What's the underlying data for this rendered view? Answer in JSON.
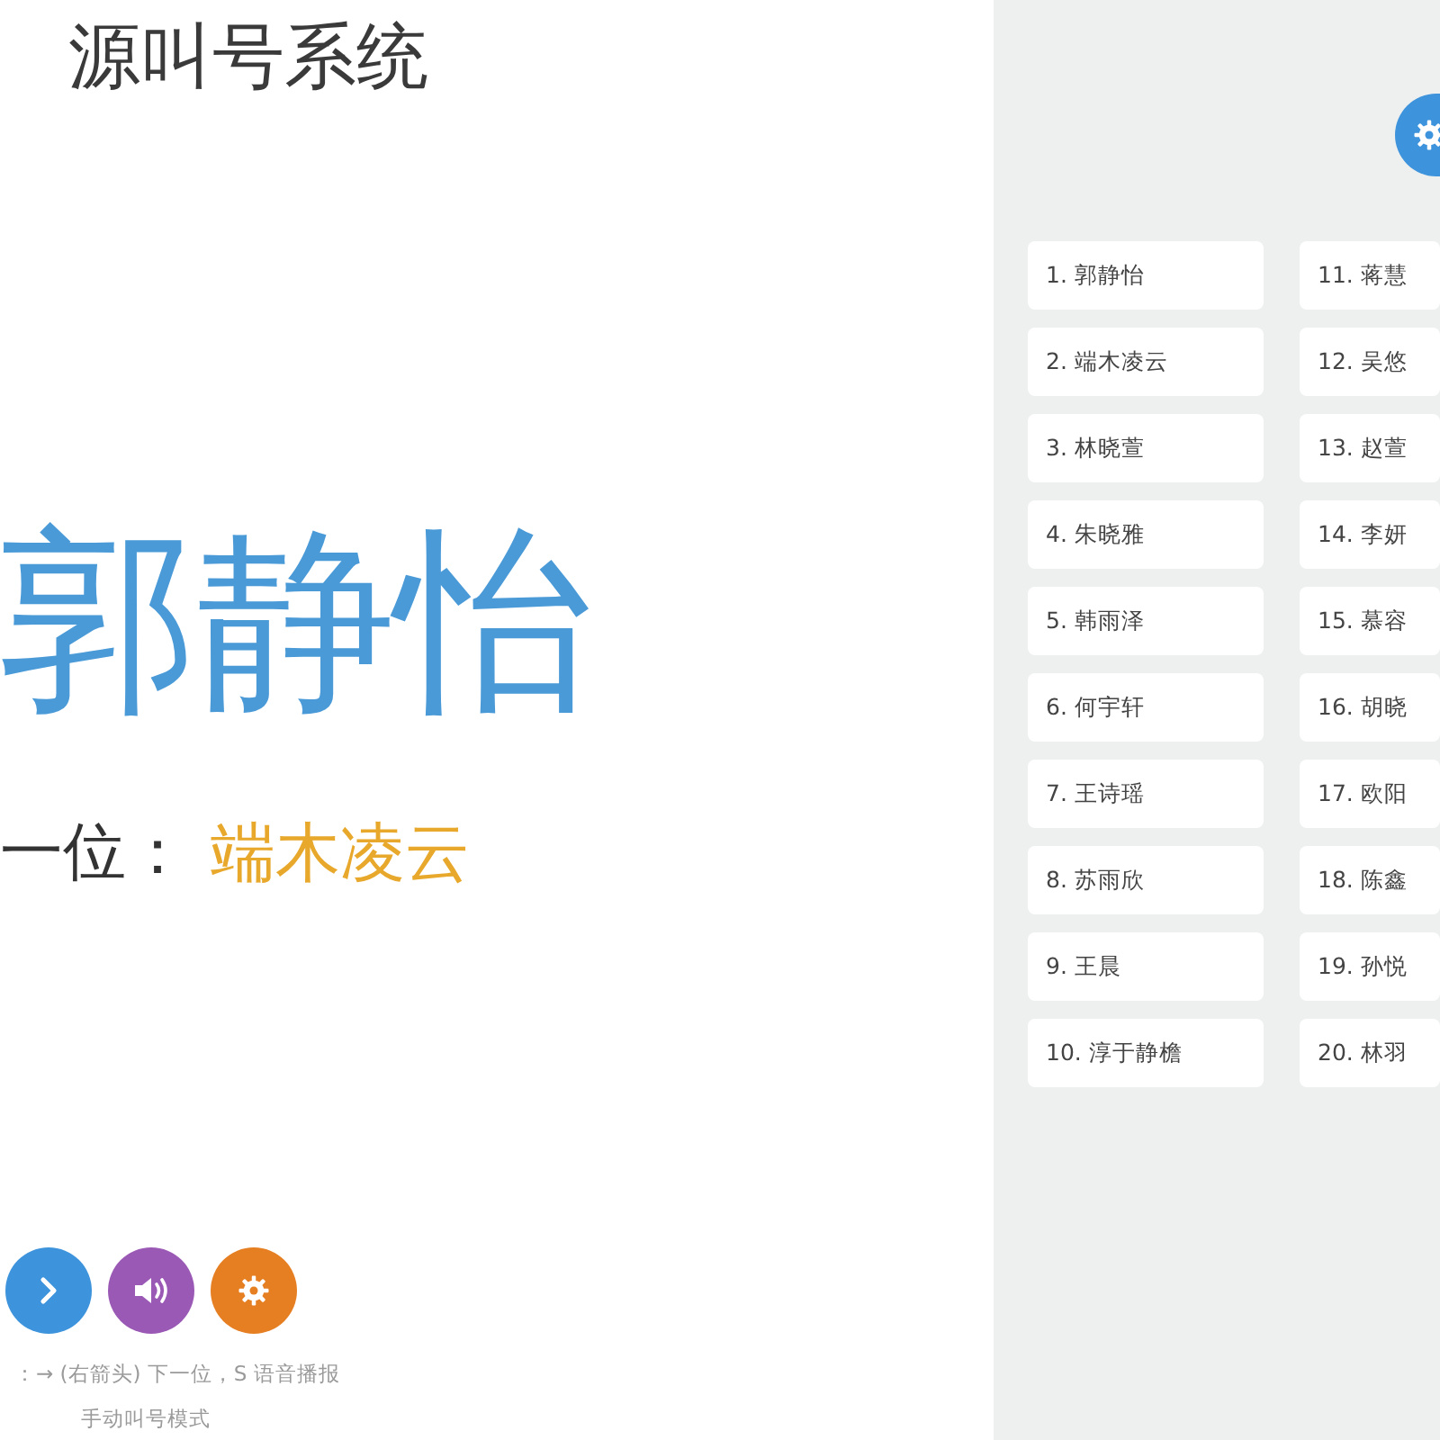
{
  "header": {
    "title": "源叫号系统"
  },
  "current": {
    "name": "郭静怡",
    "next_label": "一位：",
    "next_name": "端木凌云"
  },
  "controls": [
    {
      "kind": "next"
    },
    {
      "kind": "speak"
    },
    {
      "kind": "settings"
    }
  ],
  "shortcut_hint": "：→ (右箭头) 下一位，S 语音播报",
  "mode": "手动叫号模式",
  "queue": [
    {
      "label": "1. 郭静怡"
    },
    {
      "label": "2. 端木凌云"
    },
    {
      "label": "3. 林晓萱"
    },
    {
      "label": "4. 朱晓雅"
    },
    {
      "label": "5. 韩雨泽"
    },
    {
      "label": "6. 何宇轩"
    },
    {
      "label": "7. 王诗瑶"
    },
    {
      "label": "8. 苏雨欣"
    },
    {
      "label": "9. 王晨"
    },
    {
      "label": "10. 淳于静檐"
    },
    {
      "label": "11. 蒋慧"
    },
    {
      "label": "12. 吴悠"
    },
    {
      "label": "13. 赵萱"
    },
    {
      "label": "14. 李妍"
    },
    {
      "label": "15. 慕容"
    },
    {
      "label": "16. 胡晓"
    },
    {
      "label": "17. 欧阳"
    },
    {
      "label": "18. 陈鑫"
    },
    {
      "label": "19. 孙悦"
    },
    {
      "label": "20. 林羽"
    }
  ]
}
